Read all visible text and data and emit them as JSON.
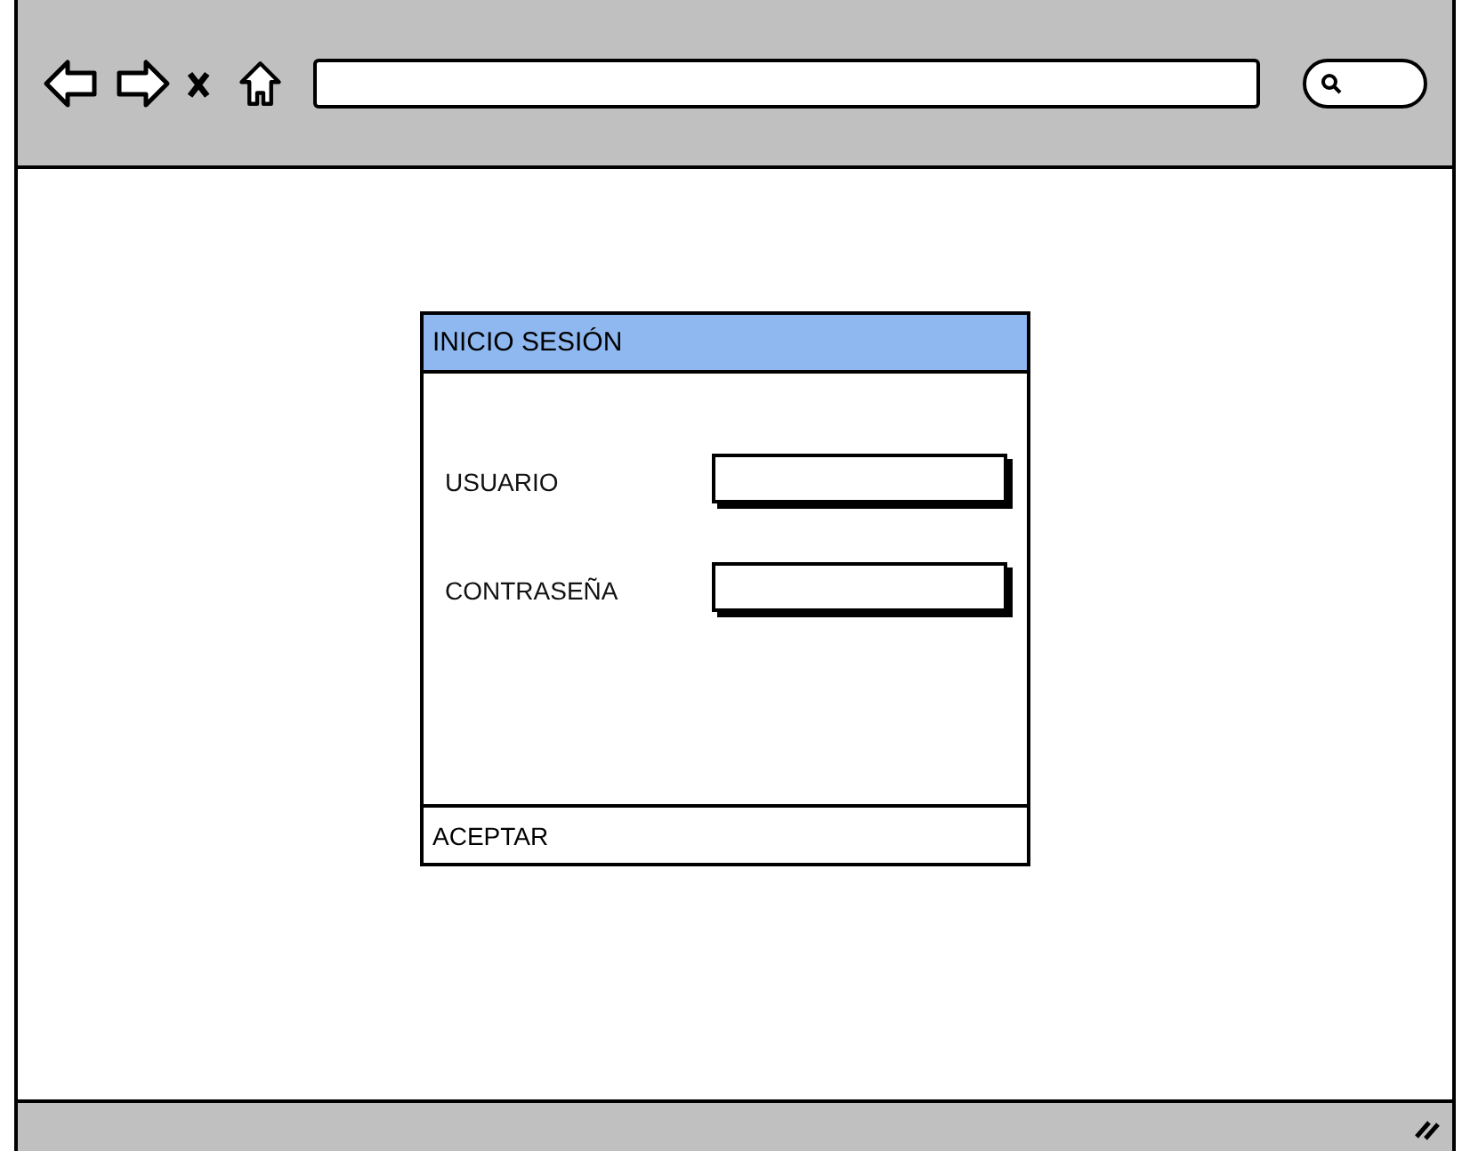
{
  "dialog": {
    "title": "INICIO SESIÓN",
    "fields": [
      {
        "label": "USUARIO"
      },
      {
        "label": "CONTRASEÑA"
      }
    ],
    "footer_button": "ACEPTAR"
  }
}
